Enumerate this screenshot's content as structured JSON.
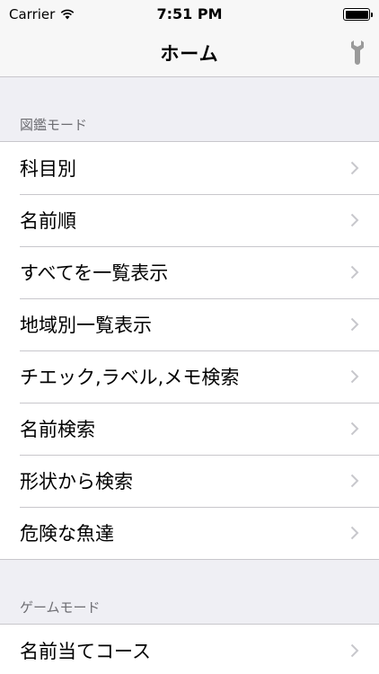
{
  "status": {
    "carrier": "Carrier",
    "time": "7:51 PM"
  },
  "nav": {
    "title": "ホーム",
    "tool_icon": "wrench-icon"
  },
  "sections": [
    {
      "header": "図鑑モード",
      "items": [
        {
          "label": "科目別"
        },
        {
          "label": "名前順"
        },
        {
          "label": "すべてを一覧表示"
        },
        {
          "label": "地域別一覧表示"
        },
        {
          "label": "チエック,ラベル,メモ検索"
        },
        {
          "label": "名前検索"
        },
        {
          "label": "形状から検索"
        },
        {
          "label": "危険な魚達"
        }
      ]
    },
    {
      "header": "ゲームモード",
      "items": [
        {
          "label": "名前当てコース"
        }
      ]
    }
  ],
  "colors": {
    "background": "#efeff4",
    "separator": "#c8c7cc",
    "chevron": "#c7c7cc",
    "section_text": "#6d6d72"
  }
}
